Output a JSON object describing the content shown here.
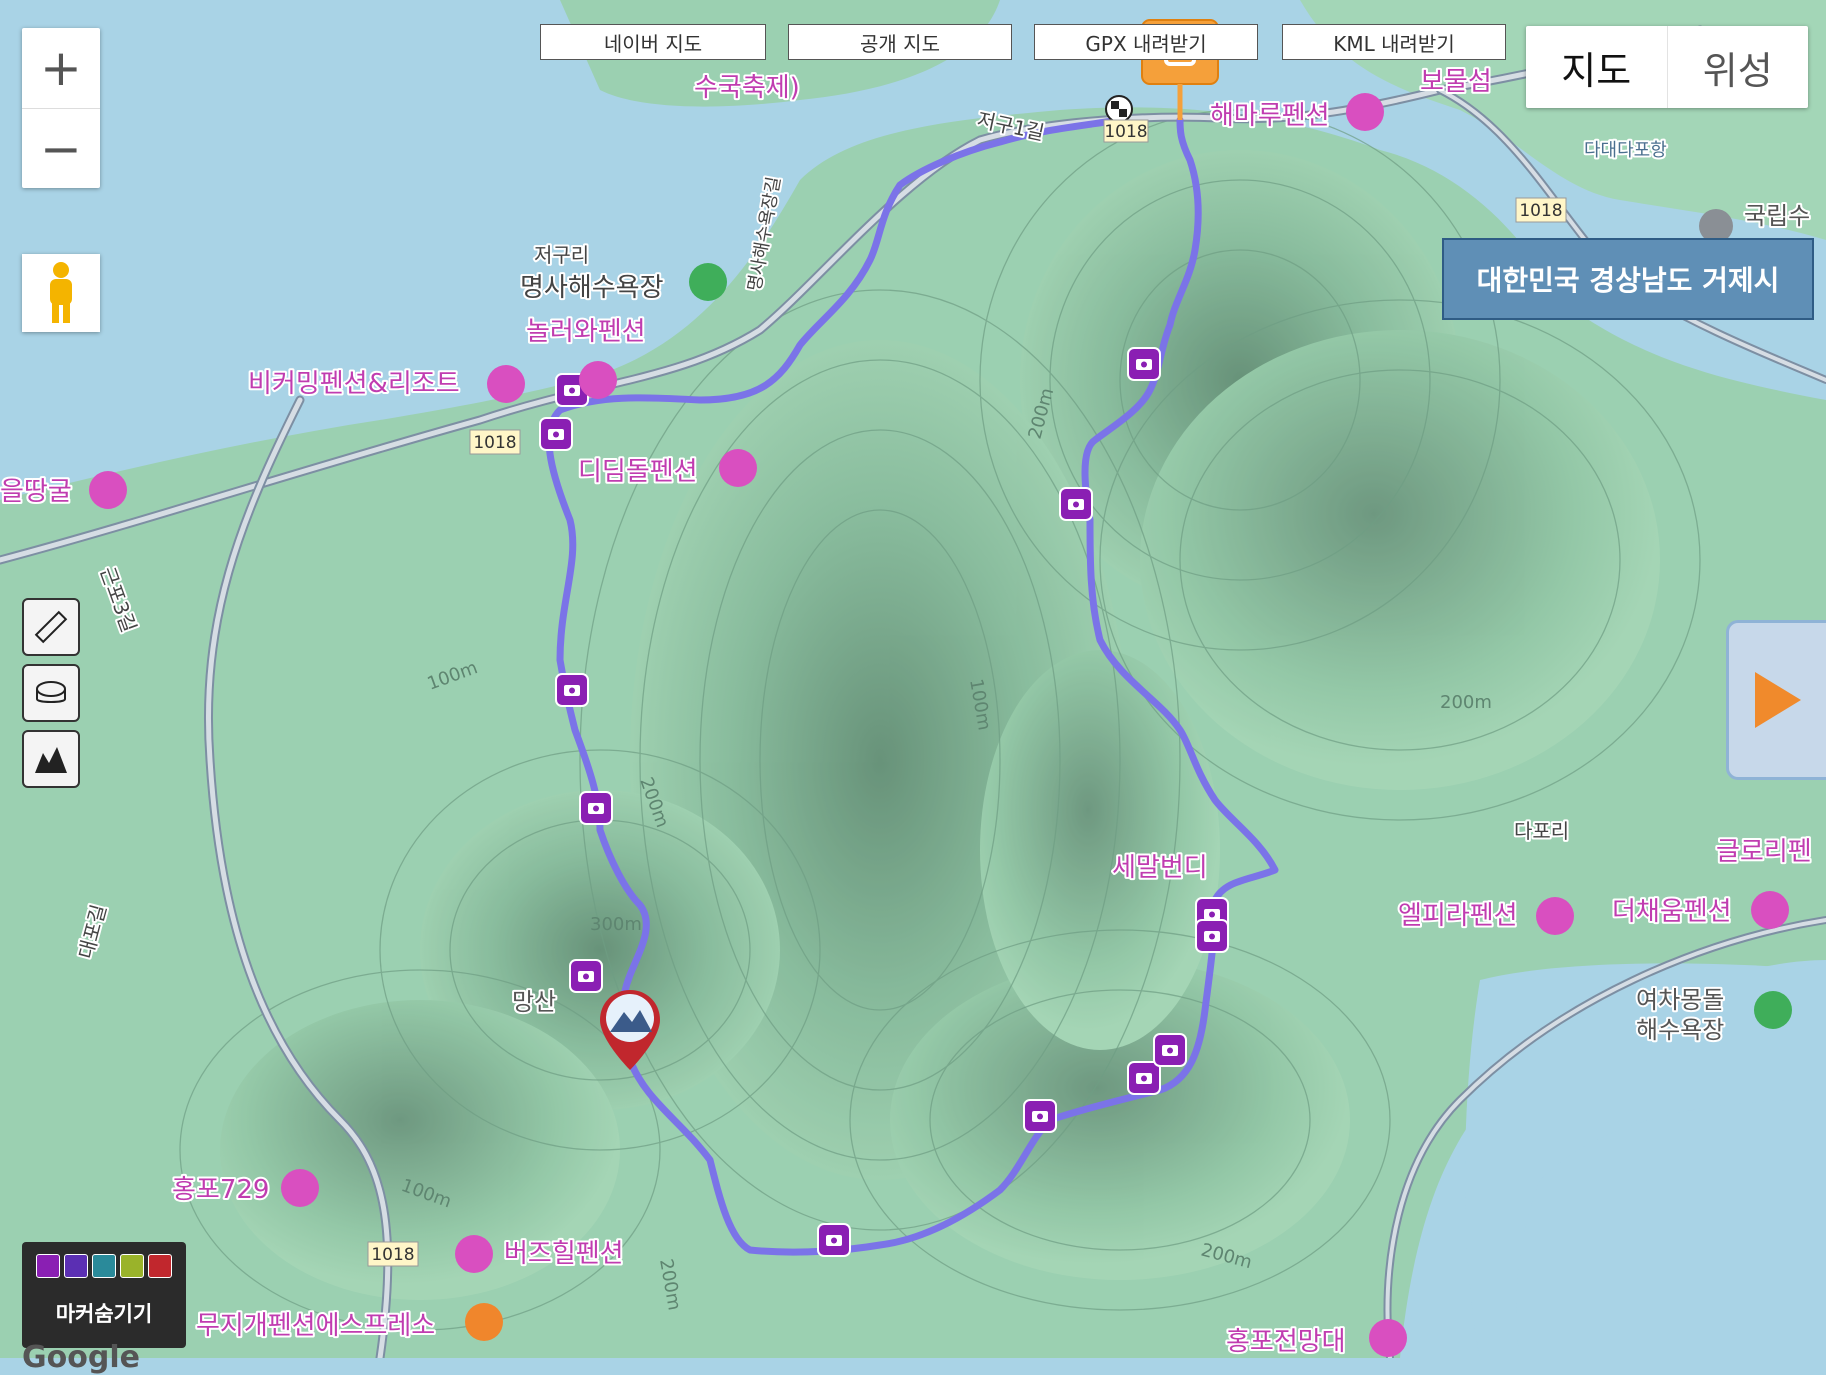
{
  "zoom": {
    "in": "+",
    "out": "−"
  },
  "top_buttons": [
    "네이버 지도",
    "공개 지도",
    "GPX 내려받기",
    "KML 내려받기"
  ],
  "map_type": {
    "map": "지도",
    "satellite": "위성"
  },
  "location": "대한민국 경상남도 거제시",
  "marker_toggle": "마커숨기기",
  "google_label": "Google",
  "colors": {
    "route": "#7b73e8",
    "photo_marker": "#8a1fb3",
    "poi": "#d94fc0",
    "water": "#a9d3e6",
    "land": "#8fc7a4"
  },
  "place_labels": [
    {
      "text": "수국축제)"
    },
    {
      "text": "저구1길"
    },
    {
      "text": "해마루펜션"
    },
    {
      "text": "보물섬"
    },
    {
      "text": "다대다포항"
    },
    {
      "text": "국립수"
    },
    {
      "text": "저구리"
    },
    {
      "text": "명사해수욕장"
    },
    {
      "text": "놀러와펜션"
    },
    {
      "text": "비커밍펜션&리조트"
    },
    {
      "text": "디딤돌펜션"
    },
    {
      "text": "을땅굴"
    },
    {
      "text": "근포3길"
    },
    {
      "text": "세말번디"
    },
    {
      "text": "다포리"
    },
    {
      "text": "글로리펜"
    },
    {
      "text": "엘피라펜션"
    },
    {
      "text": "더채움펜션"
    },
    {
      "text": "여차몽돌"
    },
    {
      "text": "해수욕장"
    },
    {
      "text": "망산"
    },
    {
      "text": "홍포729"
    },
    {
      "text": "버즈힐펜션"
    },
    {
      "text": "무지개펜션에스프레소"
    },
    {
      "text": "홍포전망대"
    },
    {
      "text": "대포길"
    },
    {
      "text": "명사해수욕장길"
    }
  ],
  "contour_labels": [
    "100m",
    "200m",
    "300m",
    "100m",
    "200m",
    "200m",
    "100m",
    "200m",
    "200m"
  ],
  "road_shields": [
    "1018",
    "1018",
    "1018",
    "1018"
  ]
}
